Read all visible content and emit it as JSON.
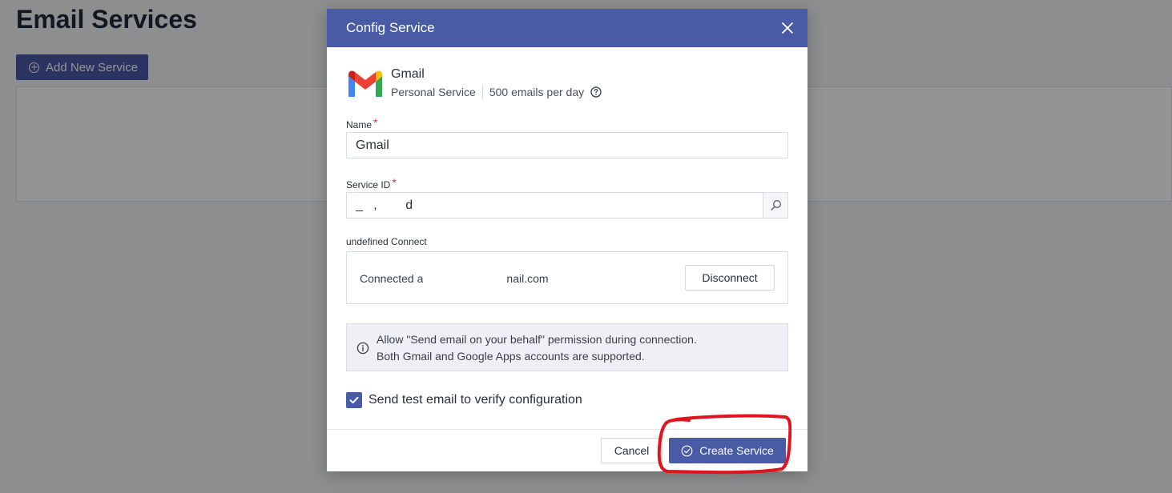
{
  "page": {
    "title": "Email Services",
    "add_button_label": "Add New Service"
  },
  "modal": {
    "title": "Config Service",
    "service": {
      "name": "Gmail",
      "type": "Personal Service",
      "quota": "500 emails per day"
    },
    "fields": {
      "name_label": "Name",
      "name_value": "Gmail",
      "service_id_label": "Service ID",
      "service_id_value": "_   ,        d",
      "required_mark": "*"
    },
    "connect": {
      "label": "undefined Connect",
      "status_prefix": "Connected a",
      "status_suffix": "nail.com",
      "disconnect_label": "Disconnect"
    },
    "info": {
      "line1": "Allow \"Send email on your behalf\" permission during connection.",
      "line2": "Both Gmail and Google Apps accounts are supported."
    },
    "test_email": {
      "label": "Send test email to verify configuration",
      "checked": true
    },
    "footer": {
      "cancel_label": "Cancel",
      "create_label": "Create Service"
    }
  },
  "colors": {
    "primary": "#4a5ba6",
    "required": "#d0314a",
    "annotation": "#e0141e"
  },
  "icons": [
    "add-circle-icon",
    "close-icon",
    "gmail-logo-icon",
    "help-icon",
    "search-icon",
    "info-icon",
    "checkmark-icon",
    "check-circle-icon"
  ]
}
